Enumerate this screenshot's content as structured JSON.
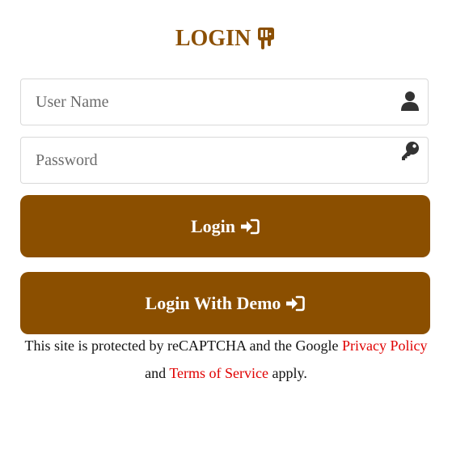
{
  "header": {
    "title": "LOGIN",
    "icon": "door-exit-icon"
  },
  "form": {
    "username": {
      "placeholder": "User Name",
      "value": "",
      "icon": "user-icon"
    },
    "password": {
      "placeholder": "Password",
      "value": "",
      "icon": "key-icon"
    }
  },
  "buttons": {
    "login_label": "Login",
    "login_icon": "sign-in-icon",
    "demo_label": "Login With Demo",
    "demo_icon": "sign-in-icon"
  },
  "recaptcha": {
    "text_before": "This site is protected by reCAPTCHA and the Google ",
    "privacy_link": "Privacy Policy",
    "text_middle": " and ",
    "terms_link": "Terms of Service",
    "text_after": " apply."
  },
  "colors": {
    "brand": "#8b4f00",
    "link": "#e00000",
    "icon": "#333333"
  }
}
